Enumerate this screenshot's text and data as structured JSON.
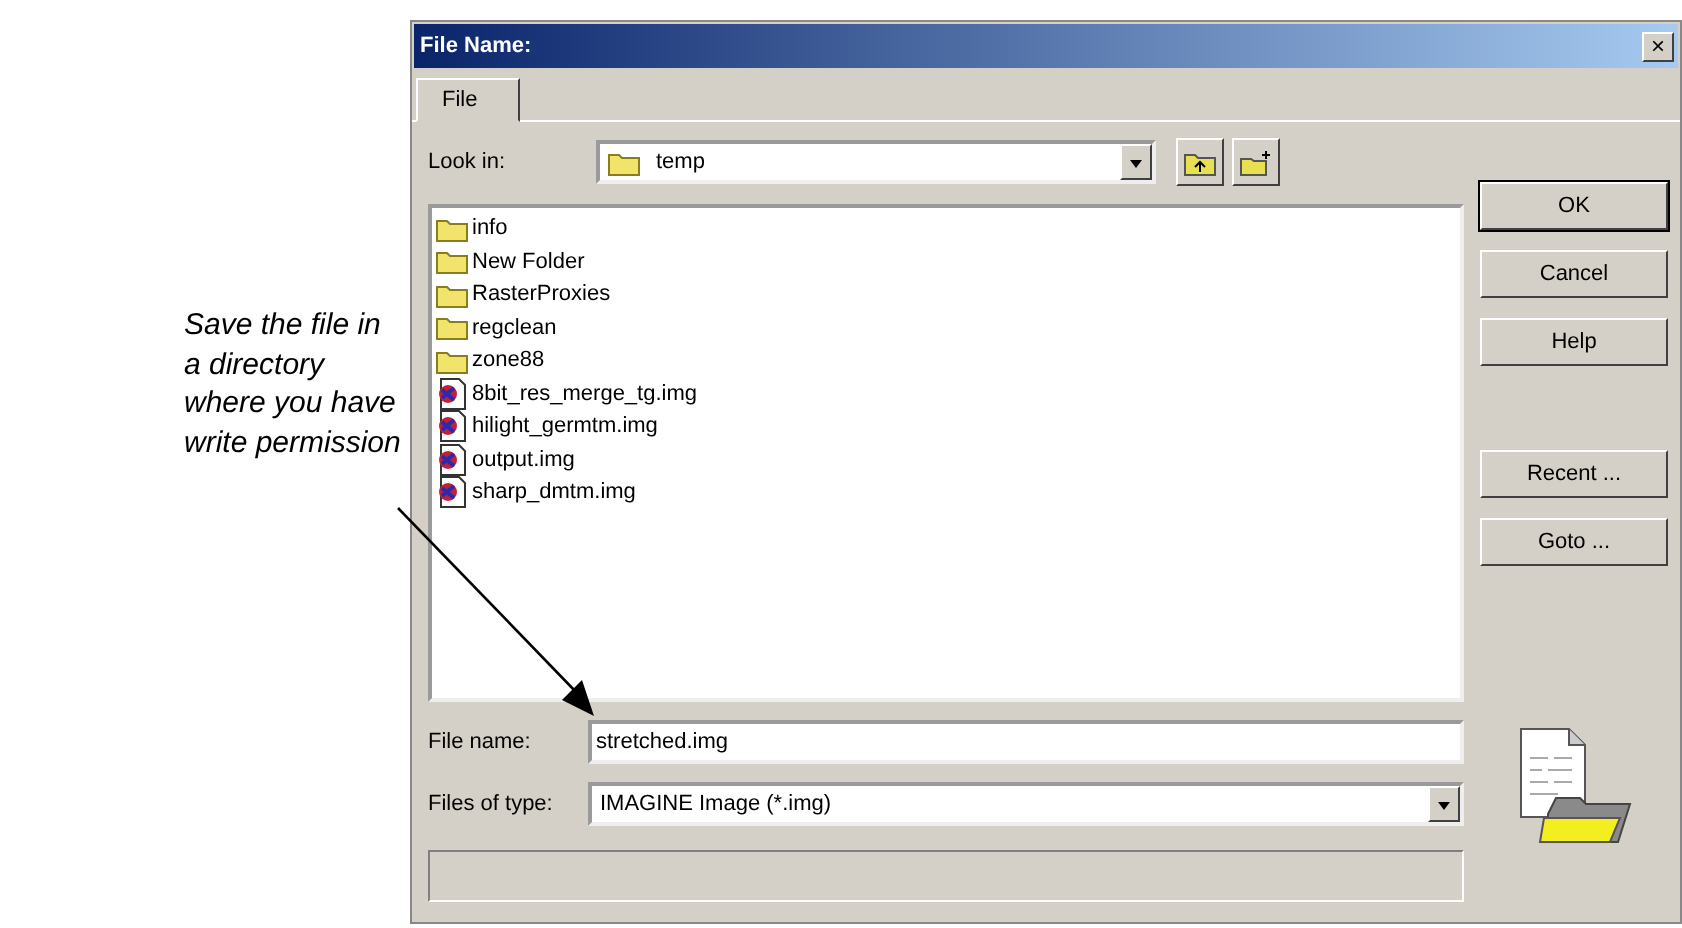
{
  "annotation": {
    "text": "Save the file in a directory where you have write permission"
  },
  "window": {
    "title": "File Name:",
    "close": "×"
  },
  "tabs": [
    {
      "label": "File",
      "selected": true
    }
  ],
  "look_in": {
    "label": "Look in:",
    "value": "temp"
  },
  "files": [
    {
      "name": "info",
      "kind": "folder"
    },
    {
      "name": "New Folder",
      "kind": "folder"
    },
    {
      "name": "RasterProxies",
      "kind": "folder"
    },
    {
      "name": "regclean",
      "kind": "folder"
    },
    {
      "name": "zone88",
      "kind": "folder"
    },
    {
      "name": "8bit_res_merge_tg.img",
      "kind": "image"
    },
    {
      "name": "hilight_germtm.img",
      "kind": "image"
    },
    {
      "name": "output.img",
      "kind": "image"
    },
    {
      "name": "sharp_dmtm.img",
      "kind": "image"
    }
  ],
  "file_name": {
    "label": "File name:",
    "value": "stretched.img"
  },
  "file_type": {
    "label": "Files of type:",
    "value": "IMAGINE Image (*.img)"
  },
  "buttons": [
    {
      "label": "OK",
      "default": true
    },
    {
      "label": "Cancel",
      "default": false
    },
    {
      "label": "Help",
      "default": false
    }
  ],
  "more_buttons": [
    {
      "label": "Recent ..."
    },
    {
      "label": "Goto ..."
    }
  ]
}
